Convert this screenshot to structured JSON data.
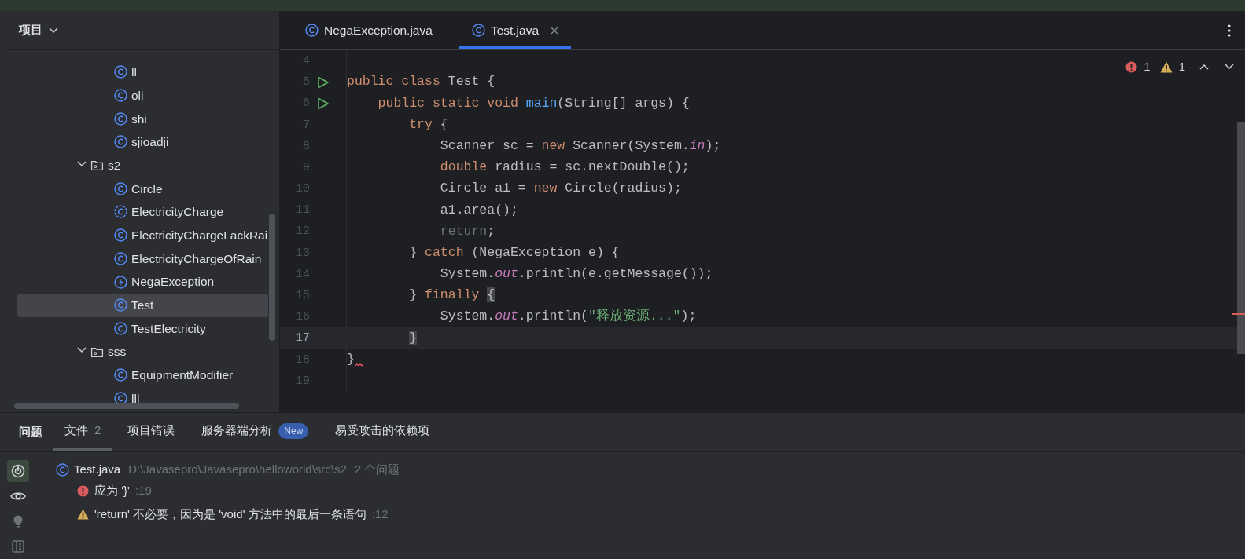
{
  "project_panel": {
    "title": "项目",
    "tree": [
      {
        "label": "ll",
        "kind": "class",
        "selected": false
      },
      {
        "label": "oli",
        "kind": "class",
        "selected": false
      },
      {
        "label": "shi",
        "kind": "class",
        "selected": false
      },
      {
        "label": "sjioadji",
        "kind": "class",
        "selected": false
      },
      {
        "label": "s2",
        "kind": "folder",
        "expanded": true,
        "selected": false,
        "children": [
          {
            "label": "Circle",
            "kind": "class",
            "selected": false
          },
          {
            "label": "ElectricityCharge",
            "kind": "abstract",
            "selected": false
          },
          {
            "label": "ElectricityChargeLackRai",
            "kind": "class",
            "selected": false
          },
          {
            "label": "ElectricityChargeOfRain",
            "kind": "class",
            "selected": false
          },
          {
            "label": "NegaException",
            "kind": "exception",
            "selected": false
          },
          {
            "label": "Test",
            "kind": "class",
            "selected": true
          },
          {
            "label": "TestElectricity",
            "kind": "class",
            "selected": false
          }
        ]
      },
      {
        "label": "sss",
        "kind": "folder",
        "expanded": true,
        "selected": false,
        "children": [
          {
            "label": "EquipmentModifier",
            "kind": "class",
            "selected": false
          },
          {
            "label": "lll",
            "kind": "class",
            "selected": false
          }
        ]
      }
    ]
  },
  "editor": {
    "tabs": [
      {
        "label": "NegaException.java",
        "selected": false
      },
      {
        "label": "Test.java",
        "selected": true
      }
    ],
    "inspections": {
      "errors": "1",
      "warnings": "1"
    },
    "lines": [
      {
        "number": "4",
        "run": false,
        "current": false,
        "error": false
      },
      {
        "number": "5",
        "run": true,
        "current": false,
        "error": false,
        "tokens": [
          {
            "text": "public class ",
            "kind": "keyword"
          },
          {
            "text": "Test {",
            "kind": "plain"
          }
        ]
      },
      {
        "number": "6",
        "run": true,
        "current": false,
        "error": false,
        "tokens": [
          {
            "text": "    public static void ",
            "kind": "keyword"
          },
          {
            "text": "main",
            "kind": "method"
          },
          {
            "text": "(String[] args) {",
            "kind": "plain"
          }
        ]
      },
      {
        "number": "7",
        "run": false,
        "current": false,
        "error": false,
        "tokens": [
          {
            "text": "        try ",
            "kind": "keyword"
          },
          {
            "text": "{",
            "kind": "plain"
          }
        ]
      },
      {
        "number": "8",
        "run": false,
        "current": false,
        "error": false,
        "tokens": [
          {
            "text": "            Scanner sc = ",
            "kind": "plain"
          },
          {
            "text": "new ",
            "kind": "keyword"
          },
          {
            "text": "Scanner(System.",
            "kind": "plain"
          },
          {
            "text": "in",
            "kind": "field"
          },
          {
            "text": ");",
            "kind": "plain"
          }
        ]
      },
      {
        "number": "9",
        "run": false,
        "current": false,
        "error": false,
        "tokens": [
          {
            "text": "            double ",
            "kind": "keyword"
          },
          {
            "text": "radius = sc.nextDouble();",
            "kind": "plain"
          }
        ]
      },
      {
        "number": "10",
        "run": false,
        "current": false,
        "error": false,
        "tokens": [
          {
            "text": "            Circle a1 = ",
            "kind": "plain"
          },
          {
            "text": "new ",
            "kind": "keyword"
          },
          {
            "text": "Circle(radius);",
            "kind": "plain"
          }
        ]
      },
      {
        "number": "11",
        "run": false,
        "current": false,
        "error": false,
        "tokens": [
          {
            "text": "            a1.area();",
            "kind": "plain"
          }
        ]
      },
      {
        "number": "12",
        "run": false,
        "current": false,
        "error": false,
        "tokens": [
          {
            "text": "            return",
            "kind": "unused"
          },
          {
            "text": ";",
            "kind": "plain"
          }
        ]
      },
      {
        "number": "13",
        "run": false,
        "current": false,
        "error": false,
        "tokens": [
          {
            "text": "        } ",
            "kind": "plain"
          },
          {
            "text": "catch ",
            "kind": "keyword"
          },
          {
            "text": "(NegaException e) {",
            "kind": "plain"
          }
        ]
      },
      {
        "number": "14",
        "run": false,
        "current": false,
        "error": false,
        "tokens": [
          {
            "text": "            System.",
            "kind": "plain"
          },
          {
            "text": "out",
            "kind": "field"
          },
          {
            "text": ".println(e.getMessage());",
            "kind": "plain"
          }
        ]
      },
      {
        "number": "15",
        "run": false,
        "current": false,
        "error": false,
        "tokens": [
          {
            "text": "        } ",
            "kind": "plain"
          },
          {
            "text": "finally ",
            "kind": "keyword"
          },
          {
            "text": "{",
            "kind": "matched"
          }
        ]
      },
      {
        "number": "16",
        "run": false,
        "current": false,
        "error": false,
        "tokens": [
          {
            "text": "            System.",
            "kind": "plain"
          },
          {
            "text": "out",
            "kind": "field"
          },
          {
            "text": ".println(",
            "kind": "plain"
          },
          {
            "text": "\"释放资源...\"",
            "kind": "string"
          },
          {
            "text": ");",
            "kind": "plain"
          }
        ]
      },
      {
        "number": "17",
        "run": false,
        "current": true,
        "error": false,
        "tokens": [
          {
            "text": "        }",
            "kind": "matched"
          }
        ]
      },
      {
        "number": "18",
        "run": false,
        "current": false,
        "error": true,
        "tokens": [
          {
            "text": "}",
            "kind": "plain"
          }
        ]
      },
      {
        "number": "19",
        "run": false,
        "current": false,
        "error": false
      }
    ]
  },
  "problems": {
    "title": "问题",
    "tabs": [
      {
        "label": "文件",
        "count": "2",
        "selected": true
      },
      {
        "label": "项目错误",
        "selected": false
      },
      {
        "label": "服务器端分析",
        "badge": "New",
        "selected": false
      },
      {
        "label": "易受攻击的依赖项",
        "selected": false
      }
    ],
    "toolbar": [
      {
        "kind": "autoscroll",
        "selected": true
      },
      {
        "kind": "preview",
        "selected": false
      },
      {
        "kind": "bulb",
        "selected": false
      },
      {
        "kind": "details",
        "selected": false
      }
    ],
    "file": {
      "name": "Test.java",
      "path": "D:\\Javasepro\\Javasepro\\helloworld\\src\\s2",
      "count": "2 个问题"
    },
    "issues": [
      {
        "kind": "error",
        "text": "应为 '}'",
        "line": ":19"
      },
      {
        "kind": "warning",
        "text": "'return' 不必要，因为是 'void' 方法中的最后一条语句",
        "line": ":12"
      }
    ]
  }
}
